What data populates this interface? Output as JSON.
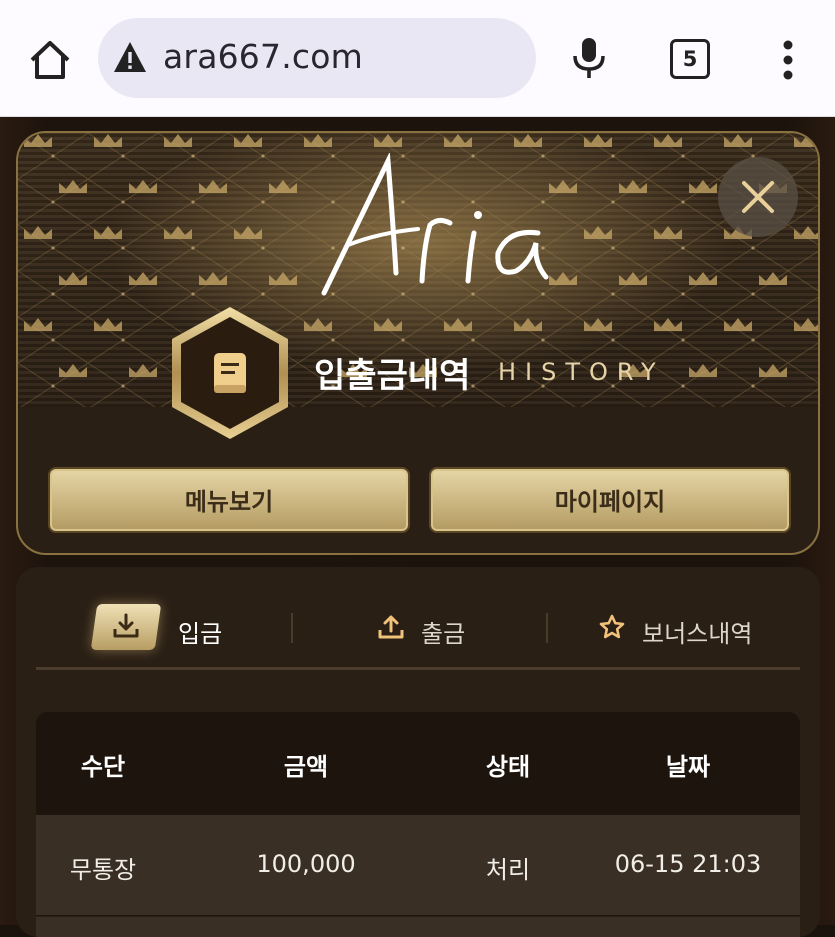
{
  "browser": {
    "url": "ara667.com",
    "tab_count": "5"
  },
  "header": {
    "logo_text": "Aria",
    "title_ko": "입출금내역",
    "title_en": "HISTORY",
    "menu_button": "메뉴보기",
    "mypage_button": "마이페이지"
  },
  "tabs": [
    {
      "label": "입금",
      "icon": "download-icon",
      "active": true
    },
    {
      "label": "출금",
      "icon": "upload-icon",
      "active": false
    },
    {
      "label": "보너스내역",
      "icon": "star-icon",
      "active": false
    }
  ],
  "table": {
    "columns": [
      "수단",
      "금액",
      "상태",
      "날짜"
    ],
    "rows": [
      {
        "method": "무통장",
        "amount": "100,000",
        "status": "처리",
        "date": "06-15 21:03"
      }
    ]
  },
  "colors": {
    "gold": "#c9b27a",
    "dark": "#2a1f15",
    "button_gold": "#e6d6a6"
  }
}
